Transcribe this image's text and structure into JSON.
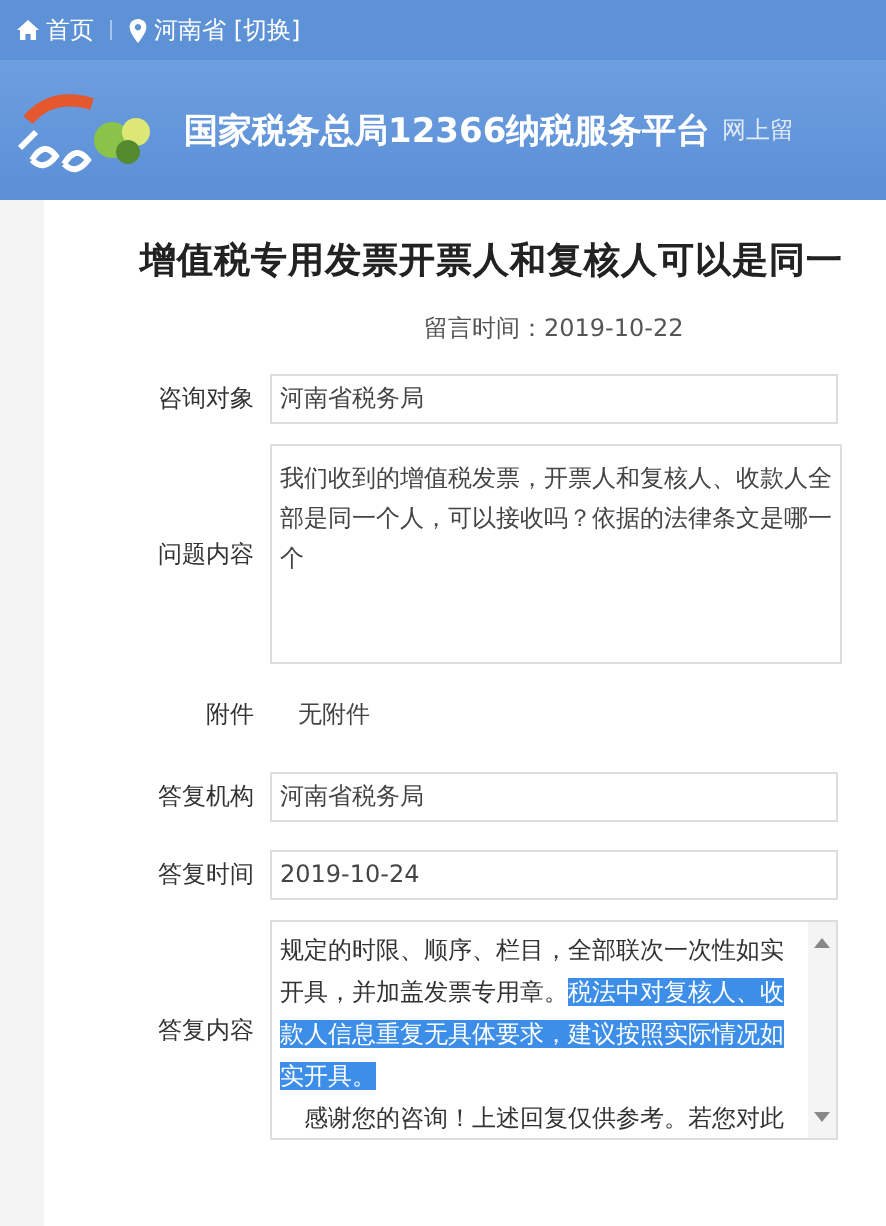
{
  "top_bar": {
    "home": "首页",
    "location": "河南省 [切换]"
  },
  "banner": {
    "title": "国家税务总局12366纳税服务平台",
    "subtitle": "网上留"
  },
  "message": {
    "title": "增值税专用发票开票人和复核人可以是同一",
    "time_label": "留言时间：",
    "time": "2019-10-22",
    "fields": [
      {
        "kind": "input",
        "label": "咨询对象",
        "value": "河南省税务局"
      },
      {
        "kind": "textarea",
        "label": "问题内容",
        "value": "我们收到的增值税发票，开票人和复核人、收款人全部是同一个人，可以接收吗？依据的法律条文是哪一个"
      },
      {
        "kind": "plain",
        "label": "附件",
        "value": "无附件"
      },
      {
        "kind": "input",
        "label": "答复机构",
        "value": "河南省税务局"
      },
      {
        "kind": "input",
        "label": "答复时间",
        "value": "2019-10-24"
      },
      {
        "kind": "reply",
        "label": "答复内容",
        "paragraphs": [
          {
            "segments": [
              {
                "text": "规定的时限、顺序、栏目，全部联次一次性如实开具，并加盖发票专用章。",
                "selected": false
              },
              {
                "text": "税法中对复核人、收款人信息重复无具体要求，建议按照实际情况如实开具。",
                "selected": true
              }
            ]
          },
          {
            "segments": [
              {
                "text": "　感谢您的咨询！上述回复仅供参考。若您对此",
                "selected": false
              }
            ]
          }
        ]
      }
    ]
  }
}
